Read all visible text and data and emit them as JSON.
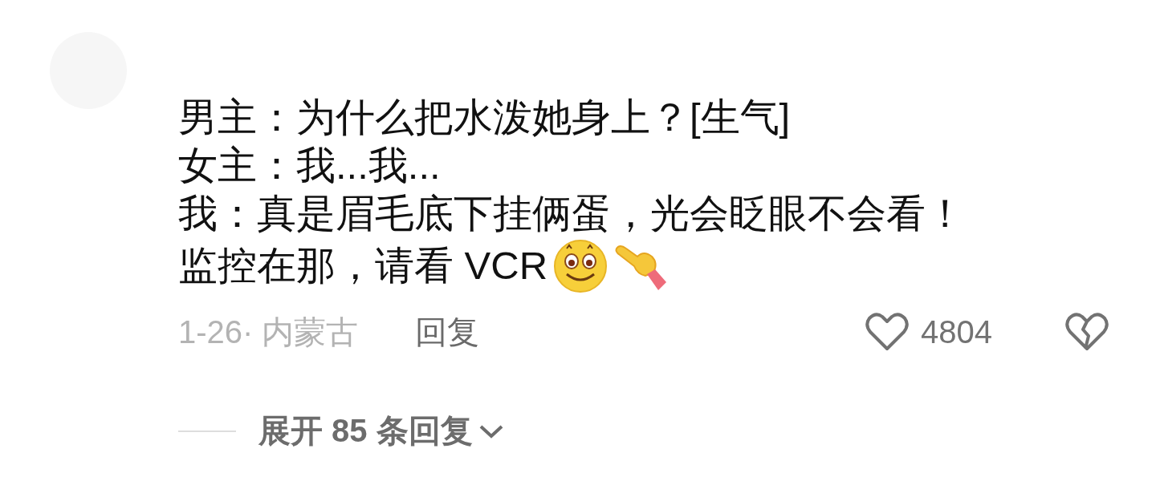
{
  "comment": {
    "lines": [
      "男主：为什么把水泼她身上？[生气]",
      "女主：我...我...",
      "我：真是眉毛底下挂俩蛋，光会眨眼不会看！",
      "监控在那，请看 VCR"
    ],
    "date_location": "1-26· 内蒙古",
    "reply": "回复",
    "likes": "4804",
    "liked": false
  },
  "expand_replies": "展开 85 条回复"
}
